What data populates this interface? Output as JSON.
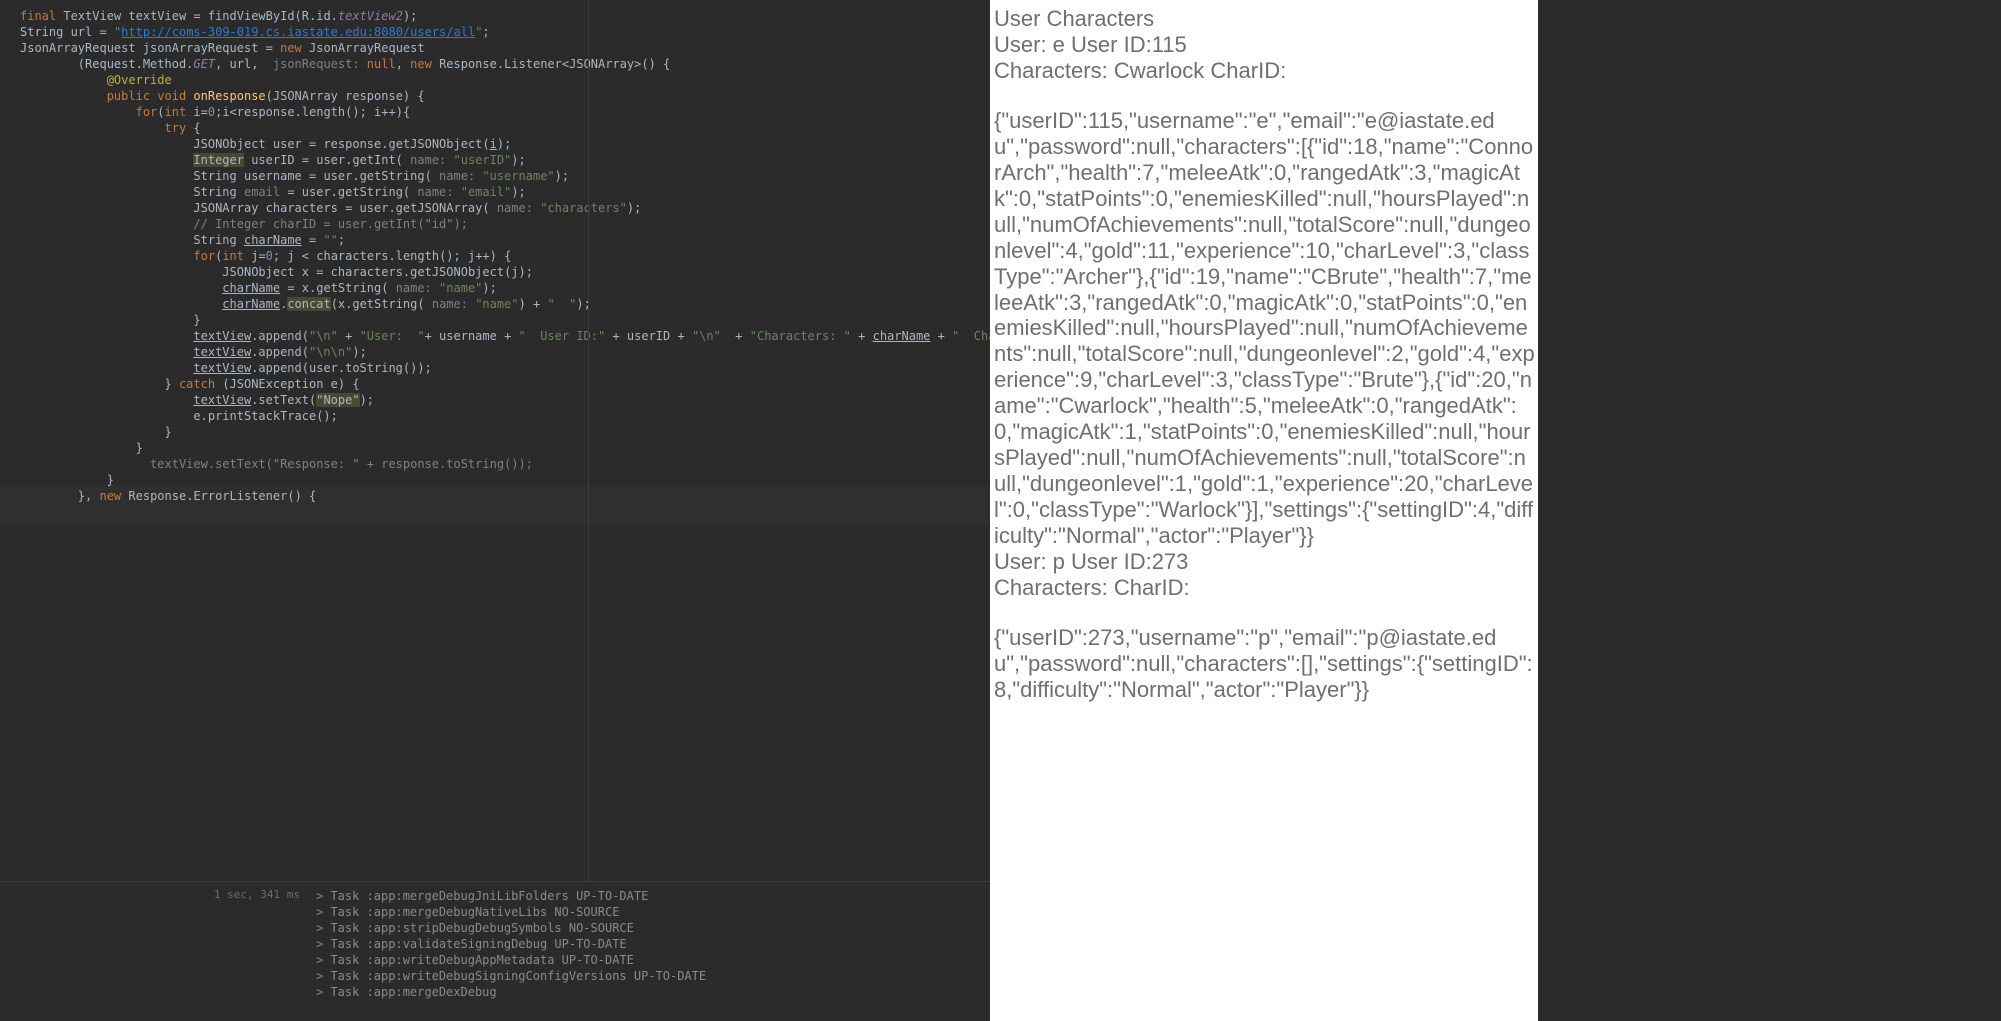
{
  "editor": {
    "lines": [
      {
        "indent": 0,
        "tokens": [
          [
            "kw",
            "final "
          ],
          [
            "type",
            "TextView "
          ],
          [
            "",
            "textView = findViewById(R.id."
          ],
          [
            "field",
            "textView2"
          ],
          [
            "",
            ");"
          ]
        ]
      },
      {
        "indent": 0,
        "tokens": [
          [
            "type",
            "String "
          ],
          [
            "",
            "url = "
          ],
          [
            "str",
            "\""
          ],
          [
            "url",
            "http://coms-309-019.cs.iastate.edu:8080/users/all"
          ],
          [
            "str",
            "\""
          ],
          [
            "",
            ";"
          ]
        ]
      },
      {
        "indent": 0,
        "tokens": [
          [
            "",
            ""
          ]
        ]
      },
      {
        "indent": 0,
        "tokens": [
          [
            "type",
            "JsonArrayRequest "
          ],
          [
            "",
            "jsonArrayRequest = "
          ],
          [
            "kw",
            "new "
          ],
          [
            "type",
            "JsonArrayRequest"
          ]
        ]
      },
      {
        "indent": 2,
        "tokens": [
          [
            "",
            "(Request.Method."
          ],
          [
            "field",
            "GET"
          ],
          [
            "",
            ", url,  "
          ],
          [
            "param",
            "jsonRequest: "
          ],
          [
            "kw",
            "null"
          ],
          [
            "",
            ", "
          ],
          [
            "kw",
            "new "
          ],
          [
            "type",
            "Response.Listener"
          ],
          [
            "",
            "<"
          ],
          [
            "type",
            "JSONArray"
          ],
          [
            "",
            ">() {"
          ]
        ]
      },
      {
        "indent": 0,
        "tokens": [
          [
            "",
            ""
          ]
        ]
      },
      {
        "indent": 3,
        "tokens": [
          [
            "ann",
            "@Override"
          ]
        ]
      },
      {
        "indent": 3,
        "tokens": [
          [
            "kw",
            "public void "
          ],
          [
            "method",
            "onResponse"
          ],
          [
            "",
            "(JSONArray response) {"
          ]
        ]
      },
      {
        "indent": 4,
        "tokens": [
          [
            "kw",
            "for"
          ],
          [
            "",
            "("
          ],
          [
            "kw",
            "int "
          ],
          [
            "",
            "i="
          ],
          [
            "num",
            "0"
          ],
          [
            "",
            ";i<response.length(); i++){"
          ]
        ]
      },
      {
        "indent": 5,
        "tokens": [
          [
            "kw",
            "try "
          ],
          [
            "",
            "{"
          ]
        ]
      },
      {
        "indent": 6,
        "tokens": [
          [
            "type",
            "JSONObject "
          ],
          [
            "",
            "user = response.getJSONObject("
          ],
          [
            "underline",
            "i"
          ],
          [
            "",
            ");"
          ]
        ]
      },
      {
        "indent": 6,
        "tokens": [
          [
            "warn",
            "Integer"
          ],
          [
            "ws",
            " "
          ],
          [
            "",
            "userID = user.getInt( "
          ],
          [
            "param",
            "name: "
          ],
          [
            "str",
            "\"userID\""
          ],
          [
            "",
            ");"
          ]
        ]
      },
      {
        "indent": 6,
        "tokens": [
          [
            "type",
            "String "
          ],
          [
            "",
            "username = user.getString( "
          ],
          [
            "param",
            "name: "
          ],
          [
            "str",
            "\"username\""
          ],
          [
            "",
            ");"
          ]
        ]
      },
      {
        "indent": 6,
        "tokens": [
          [
            "type",
            "String "
          ],
          [
            "comment",
            "email"
          ],
          [
            "ws",
            " "
          ],
          [
            "",
            "= user.getString( "
          ],
          [
            "param",
            "name: "
          ],
          [
            "str",
            "\"email\""
          ],
          [
            "",
            ");"
          ]
        ]
      },
      {
        "indent": 6,
        "tokens": [
          [
            "type",
            "JSONArray "
          ],
          [
            "",
            "characters = user.getJSONArray( "
          ],
          [
            "param",
            "name: "
          ],
          [
            "str",
            "\"characters\""
          ],
          [
            "",
            ");"
          ]
        ]
      },
      {
        "indent": 6,
        "tokens": [
          [
            "comment",
            "// Integer charID = user.getInt(\"id\");"
          ]
        ]
      },
      {
        "indent": 0,
        "tokens": [
          [
            "",
            ""
          ]
        ]
      },
      {
        "indent": 6,
        "tokens": [
          [
            "type",
            "String "
          ],
          [
            "underline",
            "charName"
          ],
          [
            "ws",
            " "
          ],
          [
            "",
            "= "
          ],
          [
            "str",
            "\"\""
          ],
          [
            "",
            ";"
          ]
        ]
      },
      {
        "indent": 6,
        "tokens": [
          [
            "kw",
            "for"
          ],
          [
            "",
            "("
          ],
          [
            "kw",
            "int "
          ],
          [
            "",
            "j="
          ],
          [
            "num",
            "0"
          ],
          [
            "",
            "; j < characters.length(); j++) {"
          ]
        ]
      },
      {
        "indent": 7,
        "tokens": [
          [
            "type",
            "JSONObject "
          ],
          [
            "",
            "x = characters.getJSONObject(j);"
          ]
        ]
      },
      {
        "indent": 7,
        "tokens": [
          [
            "underline",
            "charName"
          ],
          [
            "ws",
            " "
          ],
          [
            "",
            "= x.getString( "
          ],
          [
            "param",
            "name: "
          ],
          [
            "str",
            "\"name\""
          ],
          [
            "",
            ");"
          ]
        ]
      },
      {
        "indent": 7,
        "tokens": [
          [
            "underline",
            "charName"
          ],
          [
            "",
            "."
          ],
          [
            "warn",
            "concat"
          ],
          [
            "",
            "(x.getString( "
          ],
          [
            "param",
            "name: "
          ],
          [
            "str",
            "\"name\""
          ],
          [
            "",
            ") + "
          ],
          [
            "str",
            "\"  \""
          ],
          [
            "",
            ");"
          ]
        ]
      },
      {
        "indent": 0,
        "tokens": [
          [
            "",
            ""
          ]
        ]
      },
      {
        "indent": 6,
        "tokens": [
          [
            "",
            "}"
          ]
        ]
      },
      {
        "indent": 0,
        "tokens": [
          [
            "",
            ""
          ]
        ]
      },
      {
        "indent": 0,
        "tokens": [
          [
            "",
            ""
          ]
        ]
      },
      {
        "indent": 6,
        "tokens": [
          [
            "underline",
            "textView"
          ],
          [
            "",
            ".append("
          ],
          [
            "str",
            "\"\\n\""
          ],
          [
            "ws",
            " "
          ],
          [
            "",
            "+ "
          ],
          [
            "str",
            "\"User:  \""
          ],
          [
            "",
            "+ username + "
          ],
          [
            "str",
            "\"  User ID:\""
          ],
          [
            "ws",
            " "
          ],
          [
            "",
            "+ userID + "
          ],
          [
            "str",
            "\"\\n\""
          ],
          [
            "",
            "  + "
          ],
          [
            "str",
            "\"Characters: \""
          ],
          [
            "ws",
            " "
          ],
          [
            "",
            "+ "
          ],
          [
            "underline",
            "charName"
          ],
          [
            "ws",
            " "
          ],
          [
            "",
            "+ "
          ],
          [
            "str",
            "\"  CharID: \""
          ],
          [
            "",
            ");"
          ]
        ]
      },
      {
        "indent": 6,
        "tokens": [
          [
            "underline",
            "textView"
          ],
          [
            "",
            ".append("
          ],
          [
            "str",
            "\"\\n\\n\""
          ],
          [
            "",
            ");"
          ]
        ]
      },
      {
        "indent": 6,
        "tokens": [
          [
            "underline",
            "textView"
          ],
          [
            "",
            ".append(user.toString());"
          ]
        ]
      },
      {
        "indent": 0,
        "tokens": [
          [
            "",
            ""
          ]
        ]
      },
      {
        "indent": 5,
        "tokens": [
          [
            "",
            "} "
          ],
          [
            "kw",
            "catch "
          ],
          [
            "",
            "(JSONException e) {"
          ]
        ]
      },
      {
        "indent": 6,
        "tokens": [
          [
            "underline",
            "textView"
          ],
          [
            "",
            ".setText("
          ],
          [
            "warn",
            "\"Nope\""
          ],
          [
            "",
            ");"
          ]
        ]
      },
      {
        "indent": 6,
        "tokens": [
          [
            "",
            "e.printStackTrace();"
          ]
        ]
      },
      {
        "indent": 5,
        "tokens": [
          [
            "",
            "}"
          ]
        ]
      },
      {
        "indent": 0,
        "tokens": [
          [
            "",
            ""
          ]
        ]
      },
      {
        "indent": 4,
        "tokens": [
          [
            "",
            "}"
          ]
        ]
      },
      {
        "indent": 4,
        "tokens": [
          [
            "comment",
            "  textView.setText(\"Response: \" + response.toString());"
          ]
        ]
      },
      {
        "indent": 3,
        "tokens": [
          [
            "",
            "}"
          ]
        ]
      },
      {
        "indent": 2,
        "tokens": [
          [
            "",
            "}, "
          ],
          [
            "kw",
            "new "
          ],
          [
            "type",
            "Response.ErrorListener"
          ],
          [
            "",
            "() {"
          ]
        ]
      }
    ]
  },
  "buildOutput": {
    "timestamp": "1 sec, 341 ms",
    "lines": [
      "> Task :app:mergeDebugJniLibFolders UP-TO-DATE",
      "> Task :app:mergeDebugNativeLibs NO-SOURCE",
      "> Task :app:stripDebugDebugSymbols NO-SOURCE",
      "> Task :app:validateSigningDebug UP-TO-DATE",
      "> Task :app:writeDebugAppMetadata UP-TO-DATE",
      "> Task :app:writeDebugSigningConfigVersions UP-TO-DATE",
      "> Task :app:mergeDexDebug"
    ]
  },
  "device": {
    "title": "User Characters",
    "user1_line": "User:  e  User ID:115",
    "user1_chars": "Characters: Cwarlock  CharID:",
    "user1_json": "{\"userID\":115,\"username\":\"e\",\"email\":\"e@iastate.edu\",\"password\":null,\"characters\":[{\"id\":18,\"name\":\"ConnorArch\",\"health\":7,\"meleeAtk\":0,\"rangedAtk\":3,\"magicAtk\":0,\"statPoints\":0,\"enemiesKilled\":null,\"hoursPlayed\":null,\"numOfAchievements\":null,\"totalScore\":null,\"dungeonlevel\":4,\"gold\":11,\"experience\":10,\"charLevel\":3,\"classType\":\"Archer\"},{\"id\":19,\"name\":\"CBrute\",\"health\":7,\"meleeAtk\":3,\"rangedAtk\":0,\"magicAtk\":0,\"statPoints\":0,\"enemiesKilled\":null,\"hoursPlayed\":null,\"numOfAchievements\":null,\"totalScore\":null,\"dungeonlevel\":2,\"gold\":4,\"experience\":9,\"charLevel\":3,\"classType\":\"Brute\"},{\"id\":20,\"name\":\"Cwarlock\",\"health\":5,\"meleeAtk\":0,\"rangedAtk\":0,\"magicAtk\":1,\"statPoints\":0,\"enemiesKilled\":null,\"hoursPlayed\":null,\"numOfAchievements\":null,\"totalScore\":null,\"dungeonlevel\":1,\"gold\":1,\"experience\":20,\"charLevel\":0,\"classType\":\"Warlock\"}],\"settings\":{\"settingID\":4,\"difficulty\":\"Normal\",\"actor\":\"Player\"}}",
    "user2_line": "User:  p  User ID:273",
    "user2_chars": "Characters:   CharID:",
    "user2_json": "{\"userID\":273,\"username\":\"p\",\"email\":\"p@iastate.edu\",\"password\":null,\"characters\":[],\"settings\":{\"settingID\":8,\"difficulty\":\"Normal\",\"actor\":\"Player\"}}"
  }
}
